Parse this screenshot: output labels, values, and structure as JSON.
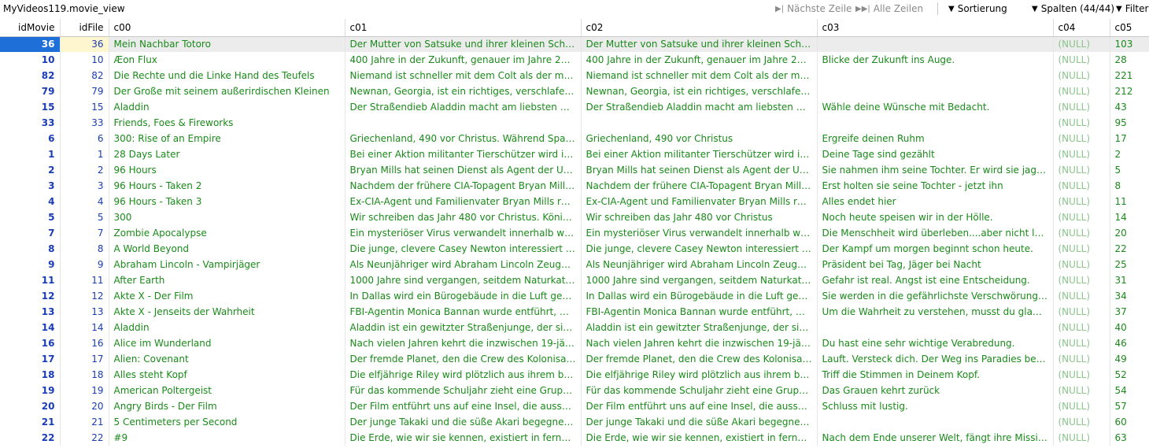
{
  "window": {
    "title": "MyVideos119.movie_view"
  },
  "toolbar": {
    "next_row": "Nächste Zeile",
    "all_rows": "Alle Zeilen",
    "sort": "Sortierung",
    "columns": "Spalten (44/44)",
    "filter": "Filter"
  },
  "columns": [
    "idMovie",
    "idFile",
    "c00",
    "c01",
    "c02",
    "c03",
    "c04",
    "c05"
  ],
  "rows": [
    [
      "36",
      "36",
      "Mein Nachbar Totoro",
      "Der Mutter von Satsuke und ihrer kleinen Schwester ...",
      "Der Mutter von Satsuke und ihrer kleinen Schwester ...",
      "",
      "(NULL)",
      "103"
    ],
    [
      "10",
      "10",
      "Æon Flux",
      "400 Jahre in der Zukunft, genauer im Jahre 2415, ist ...",
      "400 Jahre in der Zukunft, genauer im Jahre 2415, ist ...",
      "Blicke der Zukunft ins Auge.",
      "(NULL)",
      "28"
    ],
    [
      "82",
      "82",
      "Die Rechte und die Linke Hand des Teufels",
      "Niemand ist schneller mit dem Colt als der müde Jo...",
      "Niemand ist schneller mit dem Colt als der müde Jo...",
      "",
      "(NULL)",
      "221"
    ],
    [
      "79",
      "79",
      "Der Große mit seinem außerirdischen Kleinen",
      "Newnan, Georgia, ist ein richtiges, verschlafenes Pro...",
      "Newnan, Georgia, ist ein richtiges, verschlafenes Pro...",
      "",
      "(NULL)",
      "212"
    ],
    [
      "15",
      "15",
      "Aladdin",
      "Der Straßendieb Aladdin macht am liebsten mit sein...",
      "Der Straßendieb Aladdin macht am liebsten mit sein...",
      "Wähle deine Wünsche mit Bedacht.",
      "(NULL)",
      "43"
    ],
    [
      "33",
      "33",
      "Friends, Foes & Fireworks",
      "",
      "",
      "",
      "(NULL)",
      "95"
    ],
    [
      "6",
      "6",
      "300: Rise of an Empire",
      "Griechenland, 490 vor Christus. Während Spartas Kö...",
      "Griechenland, 490 vor Christus",
      "Ergreife deinen Ruhm",
      "(NULL)",
      "17"
    ],
    [
      "1",
      "1",
      "28 Days Later",
      "Bei einer Aktion militanter Tierschützer wird in Lond...",
      "Bei einer Aktion militanter Tierschützer wird in Lond...",
      "Deine Tage sind gezählt",
      "(NULL)",
      "2"
    ],
    [
      "2",
      "2",
      "96 Hours",
      "Bryan Mills hat seinen Dienst als Agent der US-Regie...",
      "Bryan Mills hat seinen Dienst als Agent der US-Regie...",
      "Sie nahmen ihm seine Tochter. Er wird sie jagen. Er ...",
      "(NULL)",
      "5"
    ],
    [
      "3",
      "3",
      "96 Hours - Taken 2",
      "Nachdem der frühere CIA-Topagent Bryan Mills im ...",
      "Nachdem der frühere CIA-Topagent Bryan Mills im ...",
      "Erst holten sie seine Tochter - jetzt ihn",
      "(NULL)",
      "8"
    ],
    [
      "4",
      "4",
      "96 Hours - Taken 3",
      "Ex-CIA-Agent und Familienvater Bryan Mills rettete ...",
      "Ex-CIA-Agent und Familienvater Bryan Mills rettete ...",
      "Alles endet hier",
      "(NULL)",
      "11"
    ],
    [
      "5",
      "5",
      "300",
      "Wir schreiben das Jahr 480 vor Christus. König Leoni...",
      "Wir schreiben das Jahr 480 vor Christus",
      "Noch heute speisen wir in der Hölle.",
      "(NULL)",
      "14"
    ],
    [
      "7",
      "7",
      "Zombie Apocalypse",
      "Ein mysteriöser Virus verwandelt innerhalb weniger ...",
      "Ein mysteriöser Virus verwandelt innerhalb weniger ...",
      "Die Menschheit wird überleben....aber nicht lebendig!",
      "(NULL)",
      "20"
    ],
    [
      "8",
      "8",
      "A World Beyond",
      "Die junge, clevere Casey Newton interessiert sich se...",
      "Die junge, clevere Casey Newton interessiert sich se...",
      "Der Kampf um morgen beginnt schon heute.",
      "(NULL)",
      "22"
    ],
    [
      "9",
      "9",
      "Abraham Lincoln - Vampirjäger",
      "Als Neunjähriger wird Abraham Lincoln Zeuge, wie ...",
      "Als Neunjähriger wird Abraham Lincoln Zeuge, wie ...",
      "Präsident bei Tag, Jäger bei Nacht",
      "(NULL)",
      "25"
    ],
    [
      "11",
      "11",
      "After Earth",
      "1000 Jahre sind vergangen, seitdem Naturkatastroph...",
      "1000 Jahre sind vergangen, seitdem Naturkatastroph...",
      "Gefahr ist real. Angst ist eine Entscheidung.",
      "(NULL)",
      "31"
    ],
    [
      "12",
      "12",
      "Akte X - Der Film",
      "In Dallas wird ein Bürogebäude in die Luft gesprengt...",
      "In Dallas wird ein Bürogebäude in die Luft gesprengt",
      "Sie werden in die gefährlichste Verschwörung ihrer K...",
      "(NULL)",
      "34"
    ],
    [
      "13",
      "13",
      "Akte X - Jenseits der Wahrheit",
      "FBI-Agentin Monica Bannan wurde entführt, möglic...",
      "FBI-Agentin Monica Bannan wurde entführt, möglic...",
      "Um die Wahrheit zu verstehen, musst du glauben.",
      "(NULL)",
      "37"
    ],
    [
      "14",
      "14",
      "Aladdin",
      "Aladdin ist ein gewitzter Straßenjunge, der sich auf d...",
      "Aladdin ist ein gewitzter Straßenjunge, der sich auf d...",
      "",
      "(NULL)",
      "40"
    ],
    [
      "16",
      "16",
      "Alice im Wunderland",
      "Nach vielen Jahren kehrt die inzwischen 19-jährige A...",
      "Nach vielen Jahren kehrt die inzwischen 19-jährige A...",
      "Du hast eine sehr wichtige Verabredung.",
      "(NULL)",
      "46"
    ],
    [
      "17",
      "17",
      "Alien: Covenant",
      "Der fremde Planet, den die Crew des Kolonisationsra...",
      "Der fremde Planet, den die Crew des Kolonisationsra...",
      "Lauft. Versteck dich. Der Weg ins Paradies beginnt in...",
      "(NULL)",
      "49"
    ],
    [
      "18",
      "18",
      "Alles steht Kopf",
      "Die elfjährige Riley wird plötzlich aus ihrem bisherig...",
      "Die elfjährige Riley wird plötzlich aus ihrem bisherig...",
      "Triff die Stimmen in Deinem Kopf.",
      "(NULL)",
      "52"
    ],
    [
      "19",
      "19",
      "American Poltergeist",
      "Für das kommende Schuljahr zieht eine Gruppe von ...",
      "Für das kommende Schuljahr zieht eine Gruppe von ...",
      "Das Grauen kehrt zurück",
      "(NULL)",
      "54"
    ],
    [
      "20",
      "20",
      "Angry Birds - Der Film",
      "Der Film entführt uns auf eine Insel, die ausschließlic...",
      "Der Film entführt uns auf eine Insel, die ausschließlic...",
      "Schluss mit lustig.",
      "(NULL)",
      "57"
    ],
    [
      "21",
      "21",
      "5 Centimeters per Second",
      "Der junge Takaki und die süße Akari begegnen, verli...",
      "Der junge Takaki und die süße Akari begegnen, verli...",
      "",
      "(NULL)",
      "60"
    ],
    [
      "22",
      "22",
      "#9",
      "Die Erde, wie wir sie kennen, existiert in ferner Zukun...",
      "Die Erde, wie wir sie kennen, existiert in ferner Zukun...",
      "Nach dem Ende unserer Welt, fängt ihre Mission an",
      "(NULL)",
      "63"
    ]
  ]
}
